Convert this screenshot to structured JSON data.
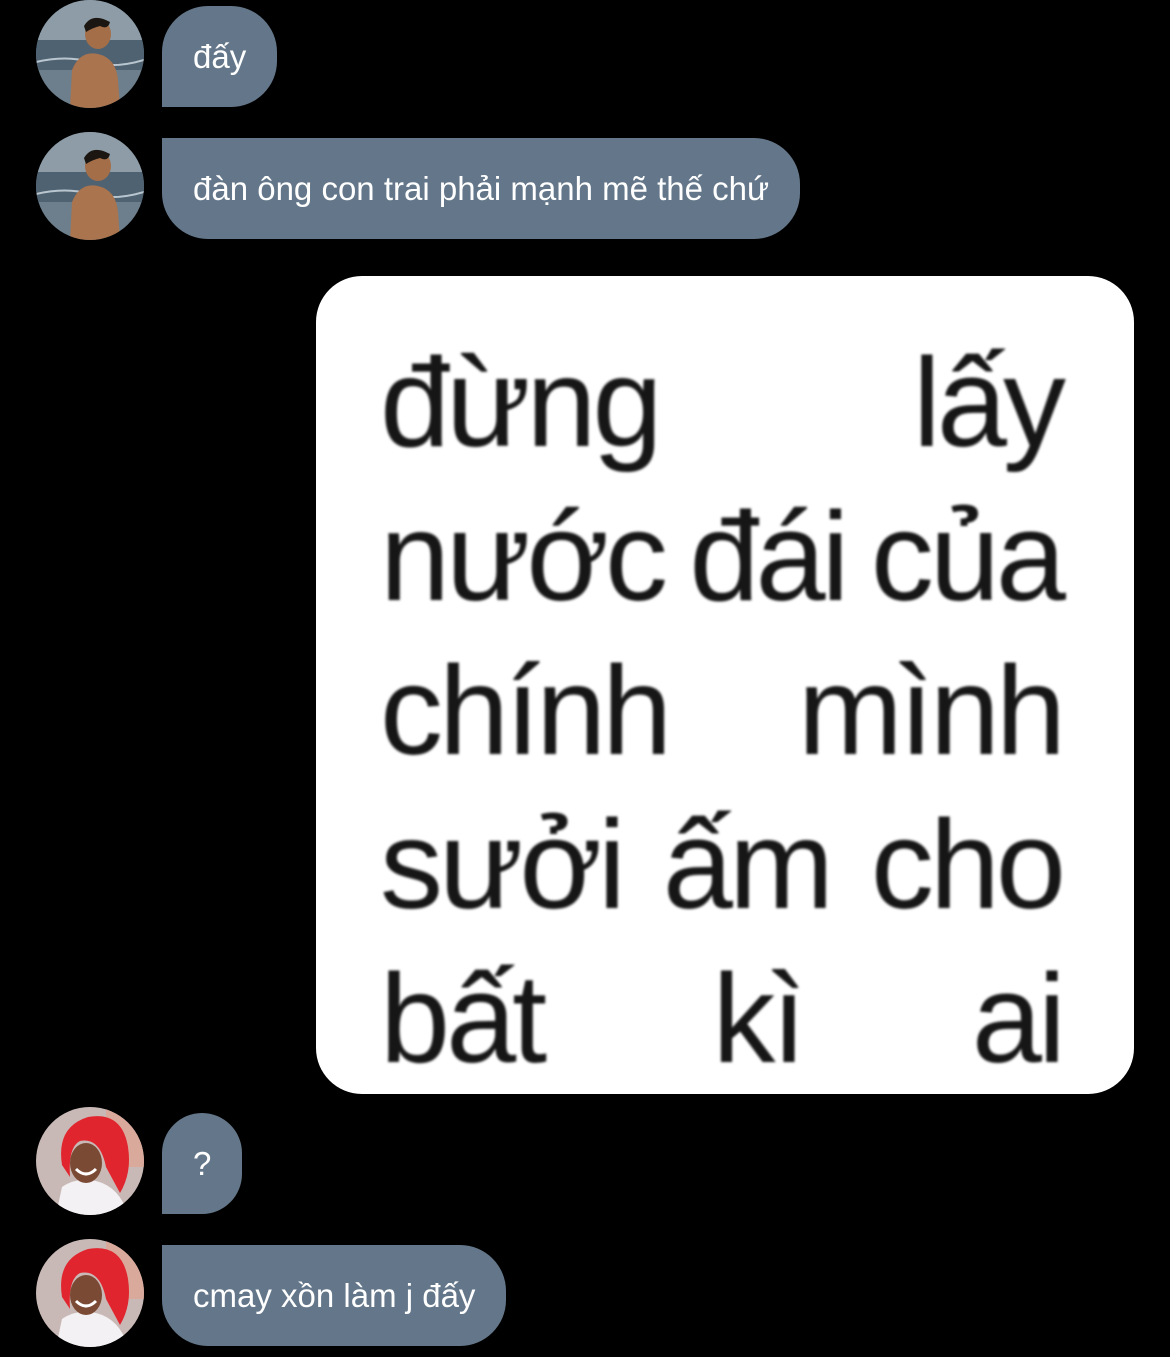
{
  "conversation": {
    "messages": [
      {
        "sender": "other_1",
        "text": "đấy"
      },
      {
        "sender": "other_1",
        "text": "đàn ông con trai phải mạnh mẽ thế chứ"
      },
      {
        "sender": "me",
        "sticker_lines": [
          [
            "đừng",
            "lấy"
          ],
          [
            "nước",
            "đái",
            "của"
          ],
          [
            "chính",
            "mình"
          ],
          [
            "sưởi",
            "ấm",
            "cho"
          ],
          [
            "bất",
            "kì",
            "ai"
          ]
        ]
      },
      {
        "sender": "other_2",
        "text": "?"
      },
      {
        "sender": "other_2",
        "text": "cmay xồn làm j đấy"
      }
    ]
  },
  "colors": {
    "background": "#000000",
    "incoming_bubble": "#64778a",
    "sticker_background": "#ffffff"
  },
  "icons": {
    "avatar_1": "shirtless-man-at-sea-avatar",
    "avatar_2": "person-red-hood-avatar"
  }
}
